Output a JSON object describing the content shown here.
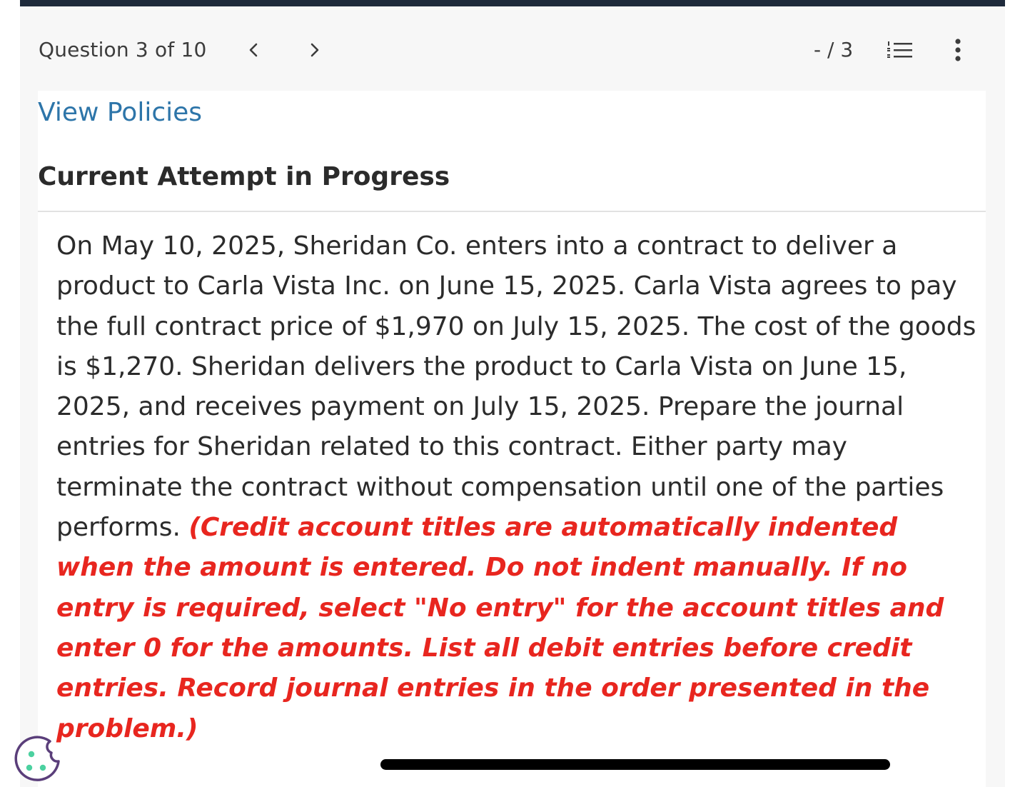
{
  "header": {
    "question_counter": "Question 3 of 10",
    "score": "- / 3",
    "prev_icon": "chevron-left-icon",
    "next_icon": "chevron-right-icon",
    "list_icon": "numbered-list-icon",
    "more_icon": "more-vertical-icon"
  },
  "content": {
    "policies_link": "View Policies",
    "attempt_heading": "Current Attempt in Progress",
    "question_text": "On May 10, 2025, Sheridan Co. enters into a contract to deliver a product to Carla Vista Inc. on June 15, 2025. Carla Vista agrees to pay the full contract price of $1,970 on July 15, 2025. The cost of the goods is $1,270. Sheridan delivers the product to Carla Vista on June 15, 2025, and receives payment on July 15, 2025. Prepare the journal entries for Sheridan related to this contract. Either party may terminate the contract without compensation until one of the parties performs.",
    "instructions": "(Credit account titles are automatically indented when the amount is entered. Do not indent manually. If no entry is required, select \"No entry\" for the account titles and enter 0 for the amounts. List all debit entries before credit entries. Record journal entries in the order presented in the problem.)"
  },
  "footer": {
    "cookie_icon": "cookie-icon"
  },
  "colors": {
    "top_bar": "#1e2a3b",
    "link": "#2d75a9",
    "instructions": "#e8261f",
    "cookie": "#5a3e7a",
    "cookie_dots": "#4cd1a0"
  }
}
